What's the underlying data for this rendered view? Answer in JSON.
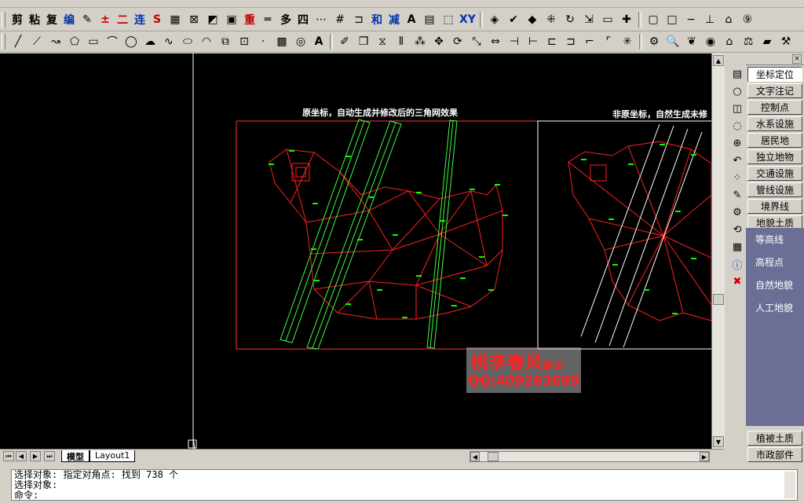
{
  "toolbar_top": {
    "text_buttons": [
      "剪",
      "粘",
      "复",
      "编",
      "±",
      "二",
      "连",
      "S",
      "重",
      "多",
      "四",
      "和",
      "减",
      "A",
      "XY"
    ]
  },
  "toolbar_draw": {
    "text_buttons": [
      "A"
    ]
  },
  "canvas": {
    "title_left": "原坐标，自动生成并修改后的三角网效果",
    "title_right": "非原坐标，自然生成未修",
    "watermark_name": "桃李春风",
    "watermark_suffix": "原创",
    "watermark_qq": "QQ:409263689",
    "colors": {
      "background": "#000000",
      "frame": "#ff3030",
      "mesh": "#ff2020",
      "strip": "#40ff40",
      "white_lines": "#ffffff",
      "labels": "#00ff00"
    }
  },
  "layout_tabs": [
    {
      "label": "模型",
      "active": true
    },
    {
      "label": "Layout1",
      "active": false
    }
  ],
  "panel": {
    "buttons": [
      "坐标定位",
      "文字注记",
      "控制点",
      "水系设施",
      "居民地",
      "独立地物",
      "交通设施",
      "管线设施",
      "境界线",
      "地貌土质"
    ],
    "active_button": "坐标定位",
    "sub_items": [
      "等高线",
      "高程点",
      "自然地貌",
      "人工地貌"
    ],
    "bottom_buttons": [
      "植被土质",
      "市政部件"
    ],
    "sub_bg": "#6b6f96"
  },
  "command": {
    "lines": [
      "选择对象: 指定对角点: 找到 738 个",
      "选择对象:",
      "命令:"
    ]
  }
}
